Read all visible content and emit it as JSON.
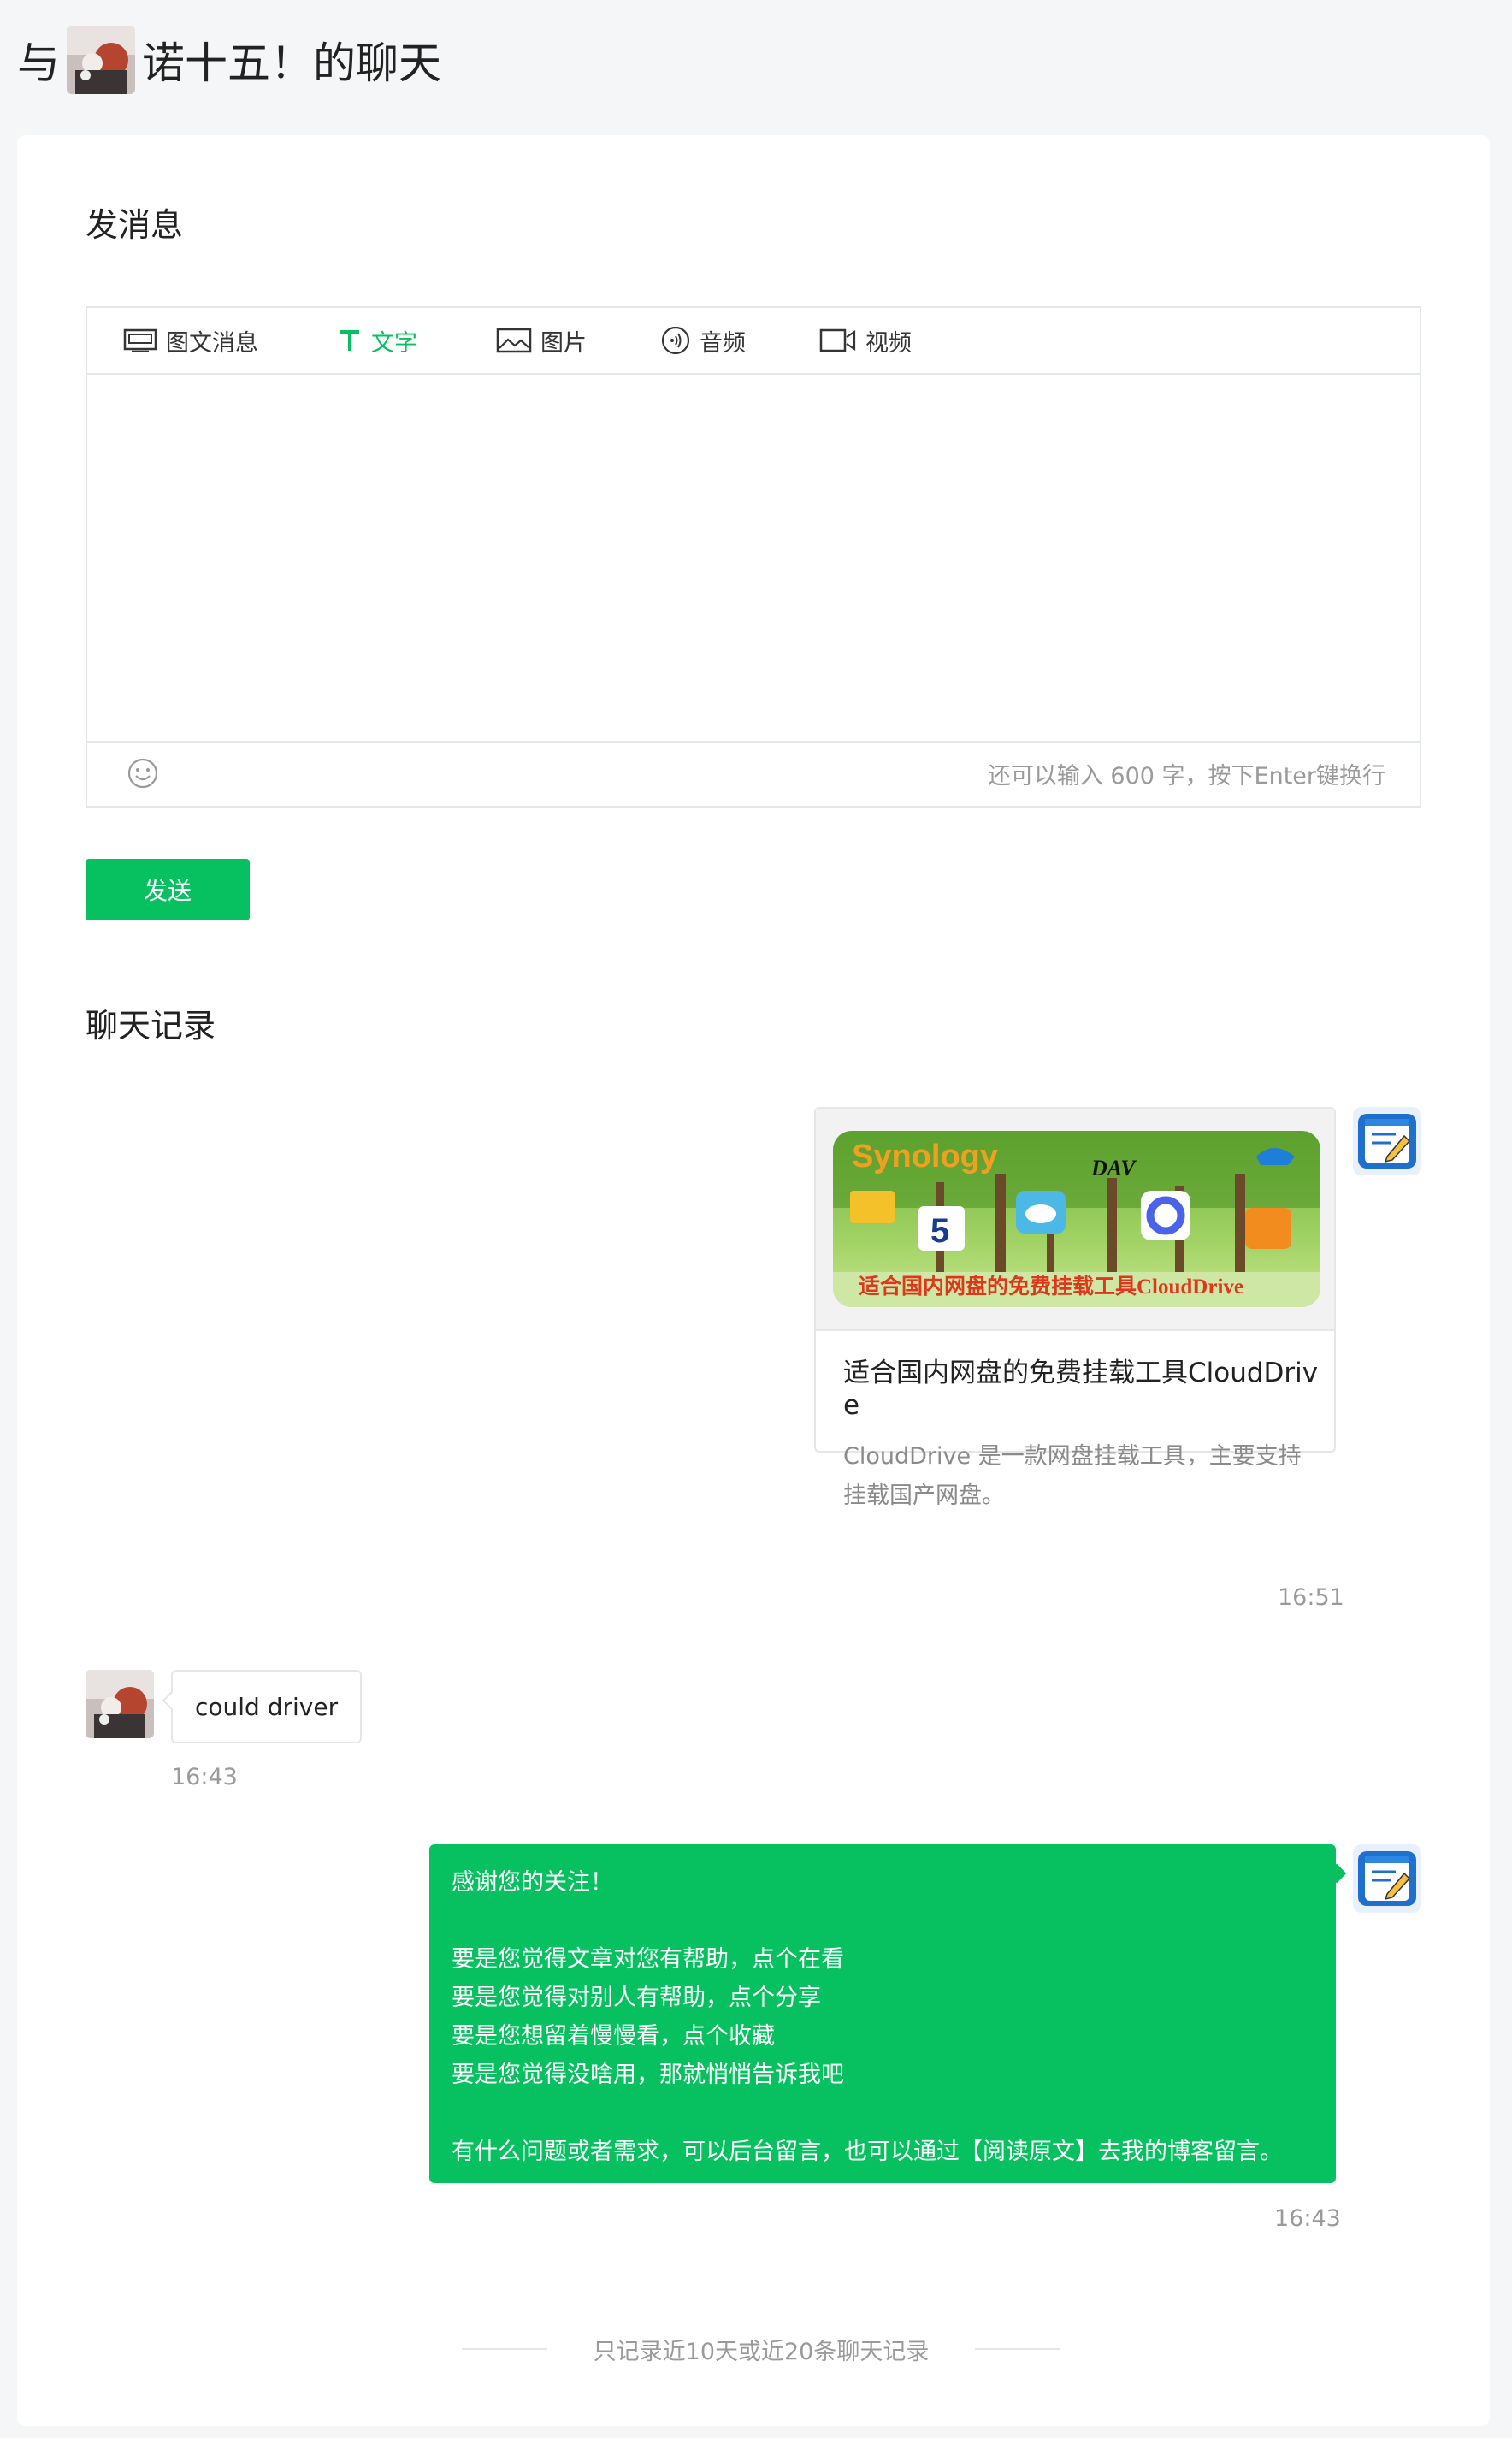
{
  "header": {
    "prefix": "与",
    "suffix": "诺十五！的聊天"
  },
  "compose": {
    "section_title": "发消息",
    "tabs": [
      {
        "label": "图文消息",
        "icon": "news-icon",
        "active": false
      },
      {
        "label": "文字",
        "icon": "text-icon",
        "active": true
      },
      {
        "label": "图片",
        "icon": "image-icon",
        "active": false
      },
      {
        "label": "音频",
        "icon": "audio-icon",
        "active": false
      },
      {
        "label": "视频",
        "icon": "video-icon",
        "active": false
      }
    ],
    "input_value": "",
    "emoji_icon": "emoji-icon",
    "counter": "还可以输入 600 字，按下Enter键换行",
    "send_label": "发送"
  },
  "history": {
    "section_title": "聊天记录",
    "messages": [
      {
        "type": "article",
        "from": "self",
        "cover_texts": [
          "Synology",
          "DAV",
          "适合国内网盘的免费挂载工具CloudDrive"
        ],
        "title": "适合国内网盘的免费挂载工具CloudDrive",
        "desc_lines": [
          "CloudDrive 是一款网盘挂载工具，主要支持",
          "挂载国产网盘。"
        ],
        "time": "16:51"
      },
      {
        "type": "text",
        "from": "user",
        "text": "could driver",
        "time": "16:43"
      },
      {
        "type": "text",
        "from": "self",
        "lines": [
          "感谢您的关注！",
          "",
          "要是您觉得文章对您有帮助，点个在看",
          "要是您觉得对别人有帮助，点个分享",
          "要是您想留着慢慢看，点个收藏",
          "要是您觉得没啥用，那就悄悄告诉我吧",
          "",
          "有什么问题或者需求，可以后台留言，也可以通过【阅读原文】去我的博客留言。"
        ],
        "time": "16:43"
      }
    ],
    "footer_note": "只记录近10天或近20条聊天记录"
  },
  "colors": {
    "accent": "#07c160",
    "page_bg": "#f5f6f7",
    "muted_text": "#9a9a9a",
    "border": "#e4e8eb"
  }
}
